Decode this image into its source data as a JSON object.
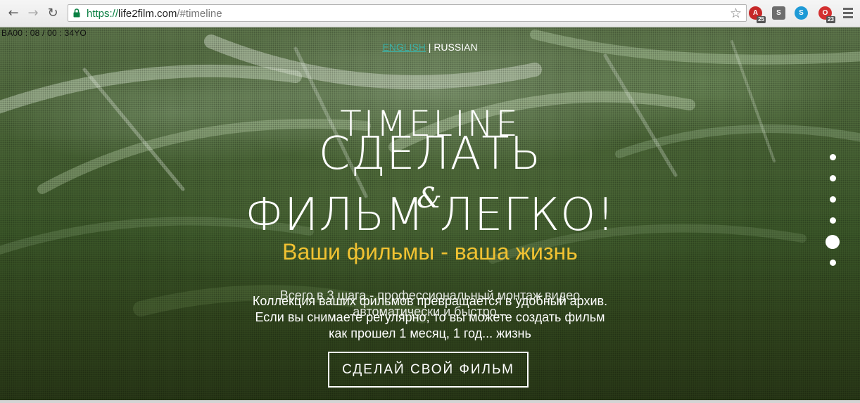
{
  "browser": {
    "url_scheme": "https://",
    "url_host": "life2film.com",
    "url_path": "/#timeline",
    "back_glyph": "←",
    "forward_glyph": "→",
    "reload_glyph": "↻",
    "star_glyph": "☆",
    "extensions": [
      {
        "name": "adblock-extension",
        "color": "#c62828",
        "letter": "A",
        "badge": "25"
      },
      {
        "name": "seo-extension",
        "color": "#6d6d6d",
        "letter": "S"
      },
      {
        "name": "skype-extension",
        "color": "#1e9ad6",
        "letter": "S"
      },
      {
        "name": "opera-extension",
        "color": "#d32f2f",
        "letter": "O",
        "badge": "23"
      }
    ]
  },
  "page": {
    "counter": "BA00 : 08 / 00 : 34YO",
    "lang_english": "ENGLISH",
    "lang_separator": "| RUSSIAN",
    "section_title": "TIMELINE",
    "headline_line1": "СДЕЛАТЬ",
    "headline_line2": "ФИЛЬМ ЛЕГКО!",
    "ampersand": "&",
    "subtitle": "Ваши фильмы - ваша жизнь",
    "para1_line1": "Всего в 3 шага - профессиональный монтаж видео",
    "para1_line2": "автоматически и быстро...",
    "para2_line1": "Коллекция ваших фильмов превращается в удобный архив.",
    "para2_line2": "Если вы снимаете регулярно, то вы можете создать фильм",
    "para2_line3": "как прошел 1 месяц, 1 год... жизнь",
    "cta_label": "СДЕЛАЙ СВОЙ ФИЛЬМ"
  },
  "colors": {
    "subtitle": "#f1c232",
    "link": "#3cb0a5",
    "url_secure": "#0b8043"
  },
  "pager": {
    "count": 6,
    "active_index": 4
  }
}
